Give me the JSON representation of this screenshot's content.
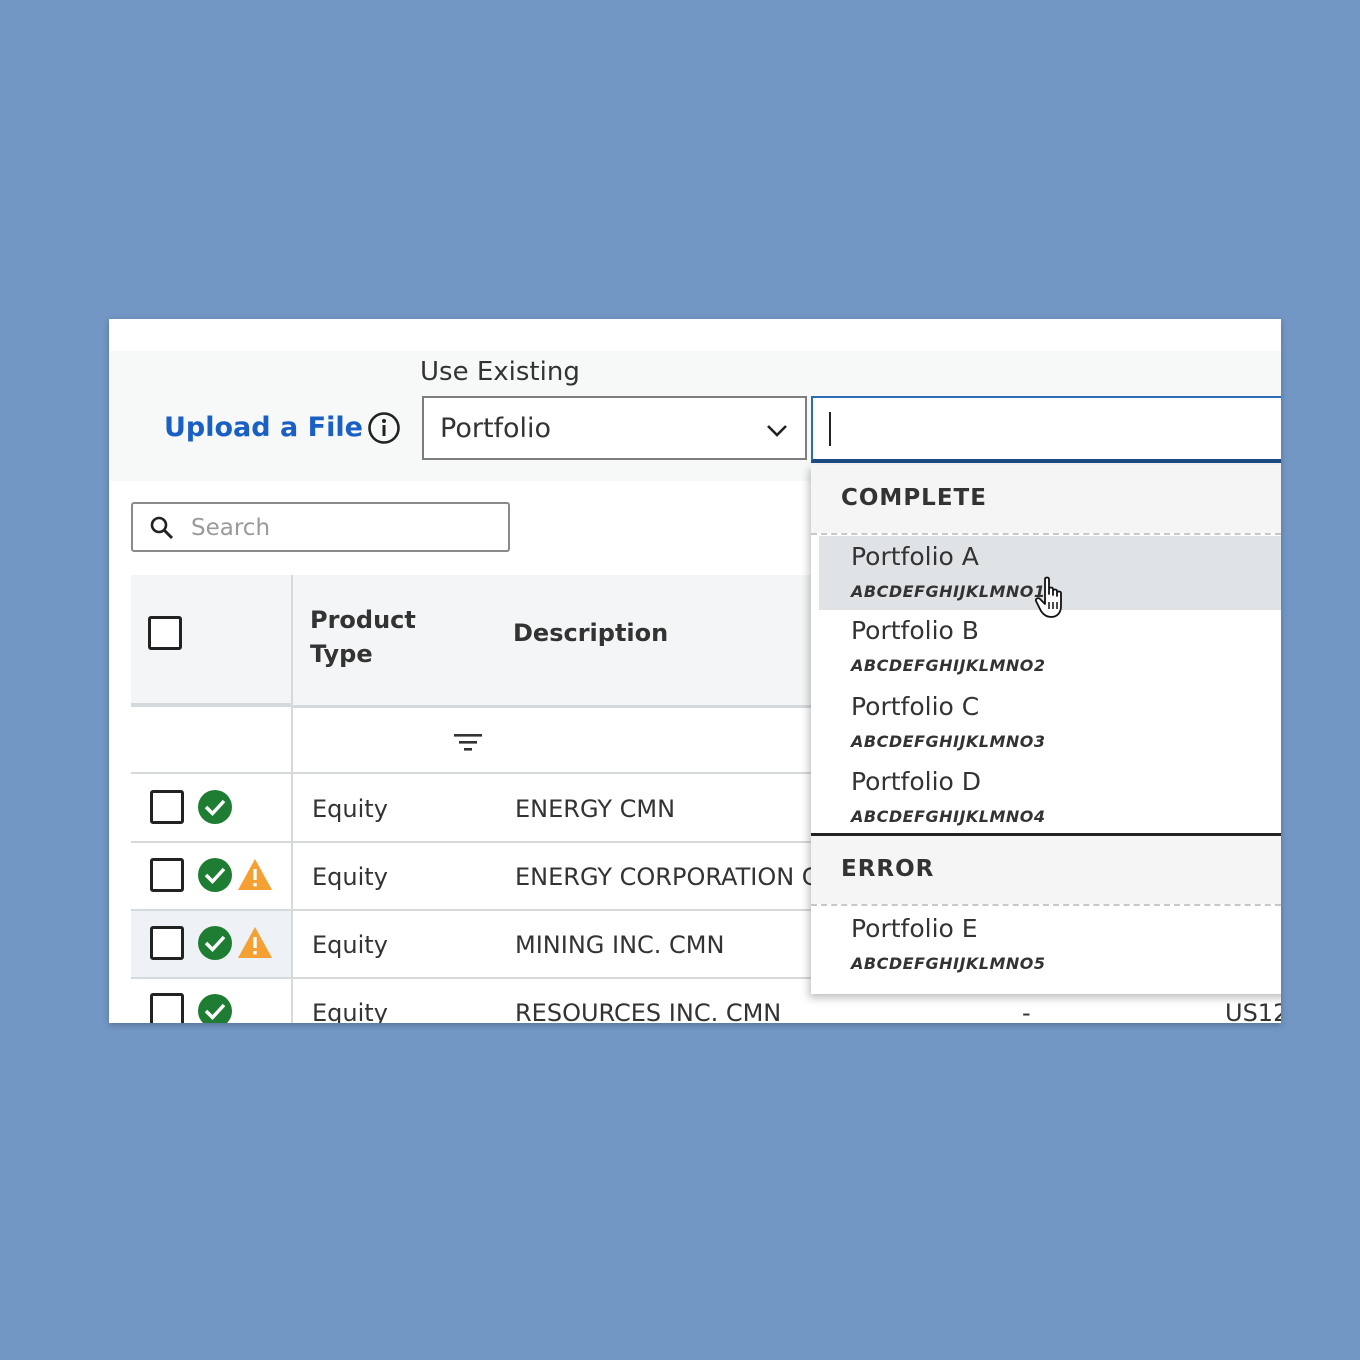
{
  "toolbar": {
    "upload_label": "Upload a File",
    "use_existing_label": "Use Existing",
    "select_value": "Portfolio",
    "combo_value": ""
  },
  "search": {
    "placeholder": "Search"
  },
  "table": {
    "headers": {
      "product_type": "Product Type",
      "description": "Description"
    },
    "rows": [
      {
        "product_type": "Equity",
        "description": "ENERGY CMN",
        "status": [
          "check"
        ]
      },
      {
        "product_type": "Equity",
        "description": "ENERGY CORPORATION CMN",
        "status": [
          "check",
          "warning"
        ]
      },
      {
        "product_type": "Equity",
        "description": "MINING INC. CMN",
        "status": [
          "check",
          "warning"
        ]
      },
      {
        "product_type": "Equity",
        "description": "RESOURCES INC. CMN",
        "status": [
          "check"
        ],
        "extra": "-",
        "code": "US12"
      }
    ]
  },
  "dropdown": {
    "groups": [
      {
        "label": "COMPLETE",
        "options": [
          {
            "name": "Portfolio A",
            "code": "ABCDEFGHIJKLMNO1"
          },
          {
            "name": "Portfolio B",
            "code": "ABCDEFGHIJKLMNO2"
          },
          {
            "name": "Portfolio C",
            "code": "ABCDEFGHIJKLMNO3"
          },
          {
            "name": "Portfolio D",
            "code": "ABCDEFGHIJKLMNO4"
          }
        ]
      },
      {
        "label": "ERROR",
        "options": [
          {
            "name": "Portfolio E",
            "code": "ABCDEFGHIJKLMNO5"
          }
        ]
      }
    ]
  },
  "colors": {
    "background": "#7297c4",
    "link": "#1a5fc4",
    "success": "#1e7d32",
    "warning": "#f5a033",
    "focus": "#2b6cb5"
  }
}
